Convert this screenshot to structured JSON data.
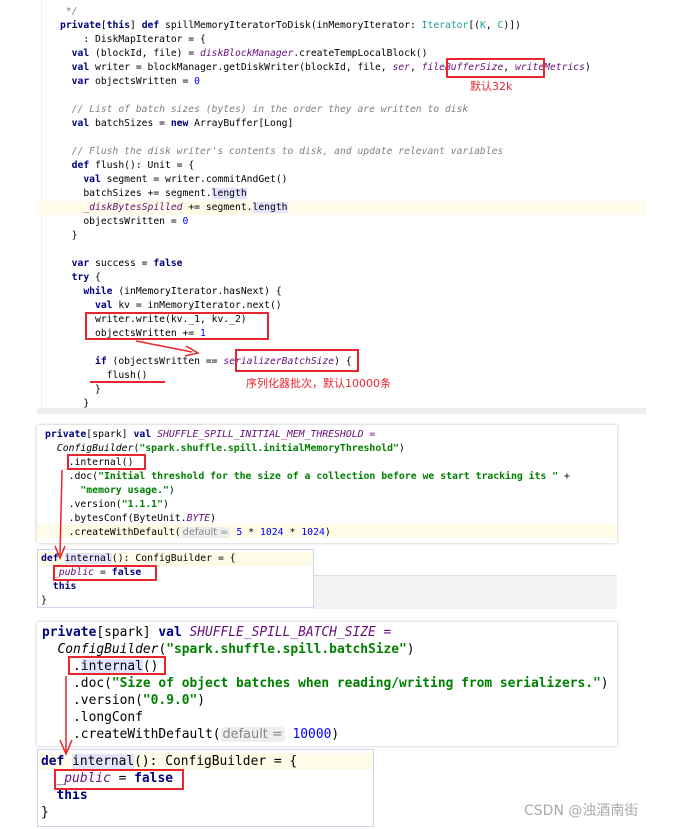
{
  "panel1": {
    "lines": [
      [
        [
          " */",
          "c"
        ]
      ],
      [
        [
          "private",
          "k"
        ],
        [
          "[",
          ""
        ],
        [
          "this",
          "k"
        ],
        [
          "] ",
          ""
        ],
        [
          "def",
          "k"
        ],
        [
          " spillMemoryIteratorToDisk(inMemoryIterator: ",
          ""
        ],
        [
          "Iterator",
          "t"
        ],
        [
          "[(",
          ""
        ],
        [
          "K",
          "t"
        ],
        [
          ", ",
          ""
        ],
        [
          "C",
          "t"
        ],
        [
          ")])",
          ""
        ]
      ],
      [
        [
          "    : DiskMapIterator = {",
          ""
        ]
      ],
      [
        [
          "  ",
          ""
        ],
        [
          "val",
          "k"
        ],
        [
          " (blockId, file) = ",
          ""
        ],
        [
          "diskBlockManager",
          "p"
        ],
        [
          ".createTempLocalBlock()",
          ""
        ]
      ],
      [
        [
          "  ",
          ""
        ],
        [
          "val",
          "k"
        ],
        [
          " writer = blockManager.getDiskWriter(blockId, file, ",
          ""
        ],
        [
          "ser",
          "p"
        ],
        [
          ", ",
          ""
        ],
        [
          "fileBufferSize",
          "p"
        ],
        [
          ", ",
          ""
        ],
        [
          "writeMetrics",
          "p"
        ],
        [
          ")",
          ""
        ]
      ],
      [
        [
          "  ",
          ""
        ],
        [
          "var",
          "k"
        ],
        [
          " objectsWritten = ",
          ""
        ],
        [
          "0",
          "n"
        ]
      ],
      [],
      [
        [
          "  // List of batch sizes (bytes) in the order they are written to disk",
          "c"
        ]
      ],
      [
        [
          "  ",
          ""
        ],
        [
          "val",
          "k"
        ],
        [
          " batchSizes = ",
          ""
        ],
        [
          "new",
          "k"
        ],
        [
          " ArrayBuffer[Long]",
          ""
        ]
      ],
      [],
      [
        [
          "  // Flush the disk writer's contents to disk, and update relevant variables",
          "c"
        ]
      ],
      [
        [
          "  ",
          ""
        ],
        [
          "def",
          "k"
        ],
        [
          " flush(): Unit = {",
          ""
        ]
      ],
      [
        [
          "    ",
          ""
        ],
        [
          "val",
          "k"
        ],
        [
          " segment = writer.commitAndGet()",
          ""
        ]
      ],
      [
        [
          "    batchSizes += segment.",
          ""
        ],
        [
          "length",
          "h"
        ]
      ],
      [
        [
          "    ",
          ""
        ],
        [
          "_diskBytesSpilled",
          "p"
        ],
        [
          " += segment.",
          ""
        ],
        [
          "length",
          "h"
        ]
      ],
      [
        [
          "    objectsWritten = ",
          ""
        ],
        [
          "0",
          "n"
        ]
      ],
      [
        [
          "  }",
          ""
        ]
      ],
      [],
      [
        [
          "  ",
          ""
        ],
        [
          "var",
          "k"
        ],
        [
          " success = ",
          ""
        ],
        [
          "false",
          "k"
        ]
      ],
      [
        [
          "  ",
          ""
        ],
        [
          "try",
          "k"
        ],
        [
          " {",
          ""
        ]
      ],
      [
        [
          "    ",
          ""
        ],
        [
          "while",
          "k"
        ],
        [
          " (inMemoryIterator.hasNext) {",
          ""
        ]
      ],
      [
        [
          "      ",
          ""
        ],
        [
          "val",
          "k"
        ],
        [
          " kv = inMemoryIterator.next()",
          ""
        ]
      ],
      [
        [
          "      writer.write(kv._1, kv._2)",
          ""
        ]
      ],
      [
        [
          "      objectsWritten += ",
          ""
        ],
        [
          "1",
          "n"
        ]
      ],
      [],
      [
        [
          "      ",
          ""
        ],
        [
          "if",
          "k"
        ],
        [
          " (objectsWritten == ",
          ""
        ],
        [
          "serializerBatchSize",
          "p"
        ],
        [
          ") {",
          ""
        ]
      ],
      [
        [
          "        flush()",
          ""
        ]
      ],
      [
        [
          "      }",
          ""
        ]
      ],
      [
        [
          "    }",
          ""
        ]
      ]
    ],
    "note_buffer": "默认32k",
    "note_batch": "序列化器批次，默认10000条"
  },
  "panel2": {
    "lines": [
      [
        [
          "private",
          "k"
        ],
        [
          "[spark] ",
          ""
        ],
        [
          "val",
          "k"
        ],
        [
          " SHUFFLE_SPILL_INITIAL_MEM_THRESHOLD =",
          "p"
        ]
      ],
      [
        [
          "  ",
          ""
        ],
        [
          "ConfigBuilder",
          "i"
        ],
        [
          "(",
          ""
        ],
        [
          "\"spark.shuffle.spill.initialMemoryThreshold\"",
          "s"
        ],
        [
          ")",
          ""
        ]
      ],
      [
        [
          "    .internal()",
          ""
        ]
      ],
      [
        [
          "    .doc(",
          ""
        ],
        [
          "\"Initial threshold for the size of a collection before we start tracking its \"",
          "s"
        ],
        [
          " +",
          ""
        ]
      ],
      [
        [
          "      ",
          ""
        ],
        [
          "\"memory usage.\"",
          "s"
        ],
        [
          ")",
          ""
        ]
      ],
      [
        [
          "    .version(",
          ""
        ],
        [
          "\"1.1.1\"",
          "s"
        ],
        [
          ")",
          ""
        ]
      ],
      [
        [
          "    .bytesConf(ByteUnit.",
          ""
        ],
        [
          "BYTE",
          "p"
        ],
        [
          ")",
          ""
        ]
      ],
      [
        [
          "    .createWithDefault(",
          ""
        ],
        [
          "default =",
          "hint"
        ],
        [
          " ",
          ""
        ],
        [
          "5",
          "n"
        ],
        [
          " * ",
          ""
        ],
        [
          "1024",
          "n"
        ],
        [
          " * ",
          ""
        ],
        [
          "1024",
          "n"
        ],
        [
          ")",
          ""
        ]
      ]
    ],
    "popup": [
      [
        [
          "def",
          "k"
        ],
        [
          " ",
          ""
        ],
        [
          "internal",
          "h"
        ],
        [
          "(): ConfigBuilder = {",
          ""
        ]
      ],
      [
        [
          "  ",
          ""
        ],
        [
          "_public",
          "p"
        ],
        [
          " = ",
          ""
        ],
        [
          "false",
          "k"
        ]
      ],
      [
        [
          "  ",
          ""
        ],
        [
          "this",
          "k"
        ]
      ],
      [
        [
          "}",
          ""
        ]
      ]
    ]
  },
  "panel3": {
    "lines": [
      [
        [
          "private",
          "k"
        ],
        [
          "[spark] ",
          ""
        ],
        [
          "val",
          "k"
        ],
        [
          " SHUFFLE_SPILL_BATCH_SIZE =",
          "p"
        ]
      ],
      [
        [
          "  ",
          ""
        ],
        [
          "ConfigBuilder",
          "i"
        ],
        [
          "(",
          ""
        ],
        [
          "\"spark.shuffle.spill.batchSize\"",
          "s"
        ],
        [
          ")",
          ""
        ]
      ],
      [
        [
          "    .",
          ""
        ],
        [
          "internal",
          "h"
        ],
        [
          "()",
          ""
        ]
      ],
      [
        [
          "    .doc(",
          ""
        ],
        [
          "\"Size of object batches when reading/writing from serializers.\"",
          "s"
        ],
        [
          ")",
          ""
        ]
      ],
      [
        [
          "    .version(",
          ""
        ],
        [
          "\"0.9.0\"",
          "s"
        ],
        [
          ")",
          ""
        ]
      ],
      [
        [
          "    .longConf",
          ""
        ]
      ],
      [
        [
          "    .createWithDefault(",
          ""
        ],
        [
          "default =",
          "hint"
        ],
        [
          " ",
          ""
        ],
        [
          "10000",
          "n"
        ],
        [
          ")",
          ""
        ]
      ]
    ],
    "popup": [
      [
        [
          "def",
          "k"
        ],
        [
          " ",
          ""
        ],
        [
          "internal",
          "h"
        ],
        [
          "(): ConfigBuilder = {",
          ""
        ]
      ],
      [
        [
          "  ",
          ""
        ],
        [
          "_public",
          "p"
        ],
        [
          " = ",
          ""
        ],
        [
          "false",
          "k"
        ]
      ],
      [
        [
          "  ",
          ""
        ],
        [
          "this",
          "k"
        ]
      ],
      [
        [
          "}",
          ""
        ]
      ]
    ]
  },
  "watermark": "CSDN @浊酒南街",
  "colors": {
    "annotation": "#e8262d",
    "keyword": "#000080",
    "string": "#008000",
    "field": "#660e7a",
    "number": "#0000ff"
  }
}
